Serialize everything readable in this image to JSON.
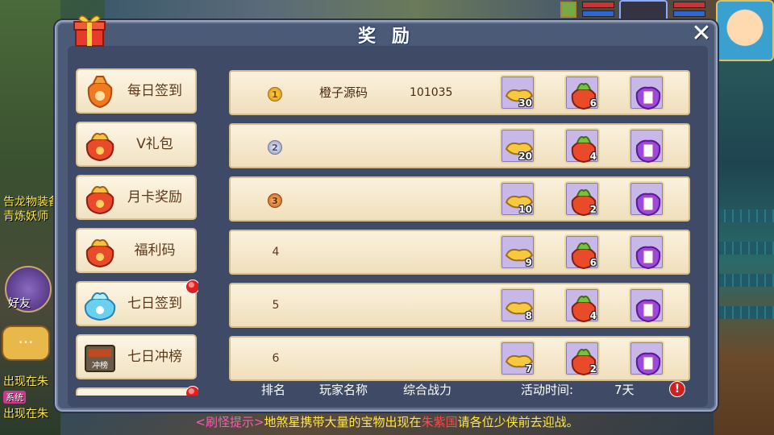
{
  "dialog": {
    "title": "奖 励",
    "close_label": "✕"
  },
  "hud": {
    "side_buttons": [
      {
        "label": "好友"
      }
    ],
    "chat_label": "···",
    "left_texts": [
      "告龙物装备",
      "青炼妖师",
      "出现在朱",
      "系统",
      "出现在朱"
    ]
  },
  "sidebar": {
    "items": [
      {
        "label": "每日签到",
        "icon": "orange-bag-icon",
        "badge": false
      },
      {
        "label": "V礼包",
        "icon": "gift-bag-icon",
        "badge": false
      },
      {
        "label": "月卡奖励",
        "icon": "gift-bag-icon",
        "badge": false
      },
      {
        "label": "福利码",
        "icon": "gift-bag-icon",
        "badge": false
      },
      {
        "label": "七日签到",
        "icon": "blue-bag-icon",
        "badge": true
      },
      {
        "label": "七日冲榜",
        "icon": "ranking-chest-icon",
        "icon_text": "冲榜",
        "badge": false
      },
      {
        "label": "",
        "icon": "gift-bag-icon",
        "badge": true
      }
    ]
  },
  "rankings": {
    "rows": [
      {
        "rank": "1",
        "rank_style": "gold",
        "name": "橙子源码",
        "power": "101035",
        "items": [
          {
            "icon": "gold-ingot-icon",
            "count": "30"
          },
          {
            "icon": "red-treasure-bag-icon",
            "count": "6"
          },
          {
            "icon": "purple-scroll-bag-icon",
            "count": ""
          }
        ]
      },
      {
        "rank": "2",
        "rank_style": "silver",
        "name": "",
        "power": "",
        "items": [
          {
            "icon": "gold-ingot-icon",
            "count": "20"
          },
          {
            "icon": "red-treasure-bag-icon",
            "count": "4"
          },
          {
            "icon": "purple-scroll-bag-icon",
            "count": ""
          }
        ]
      },
      {
        "rank": "3",
        "rank_style": "bronze",
        "name": "",
        "power": "",
        "items": [
          {
            "icon": "gold-ingot-icon",
            "count": "10"
          },
          {
            "icon": "red-treasure-bag-icon",
            "count": "2"
          },
          {
            "icon": "purple-scroll-bag-icon",
            "count": ""
          }
        ]
      },
      {
        "rank": "4",
        "rank_style": "plain",
        "name": "",
        "power": "",
        "items": [
          {
            "icon": "gold-ingot-icon",
            "count": "9"
          },
          {
            "icon": "red-treasure-bag-icon",
            "count": "6"
          },
          {
            "icon": "purple-scroll-bag-icon",
            "count": ""
          }
        ]
      },
      {
        "rank": "5",
        "rank_style": "plain",
        "name": "",
        "power": "",
        "items": [
          {
            "icon": "gold-ingot-icon",
            "count": "8"
          },
          {
            "icon": "red-treasure-bag-icon",
            "count": "4"
          },
          {
            "icon": "purple-scroll-bag-icon",
            "count": ""
          }
        ]
      },
      {
        "rank": "6",
        "rank_style": "plain",
        "name": "",
        "power": "",
        "items": [
          {
            "icon": "gold-ingot-icon",
            "count": "7"
          },
          {
            "icon": "red-treasure-bag-icon",
            "count": "2"
          },
          {
            "icon": "purple-scroll-bag-icon",
            "count": ""
          }
        ]
      }
    ]
  },
  "footer": {
    "col_rank": "排名",
    "col_player": "玩家名称",
    "col_power": "综合战力",
    "activity_label": "活动时间:",
    "activity_value": "7天",
    "warn_label": "!"
  },
  "system_message": {
    "tag": "<刷怪提示>",
    "part1": "地煞星携带大量的宝物出现在",
    "location": "朱紫国",
    "part2": "请各位少侠前去迎战。"
  },
  "colors": {
    "dialog_bg": "#4b5a76",
    "row_bg": "#fbf1dd",
    "sidebar_bg": "#fdf5e4",
    "item_slot_bg": "#c8b8e8",
    "badge_red": "#e02020",
    "message_tag": "#ff5ab4",
    "message_text": "#ffe74a",
    "message_location": "#ff4a4a"
  }
}
